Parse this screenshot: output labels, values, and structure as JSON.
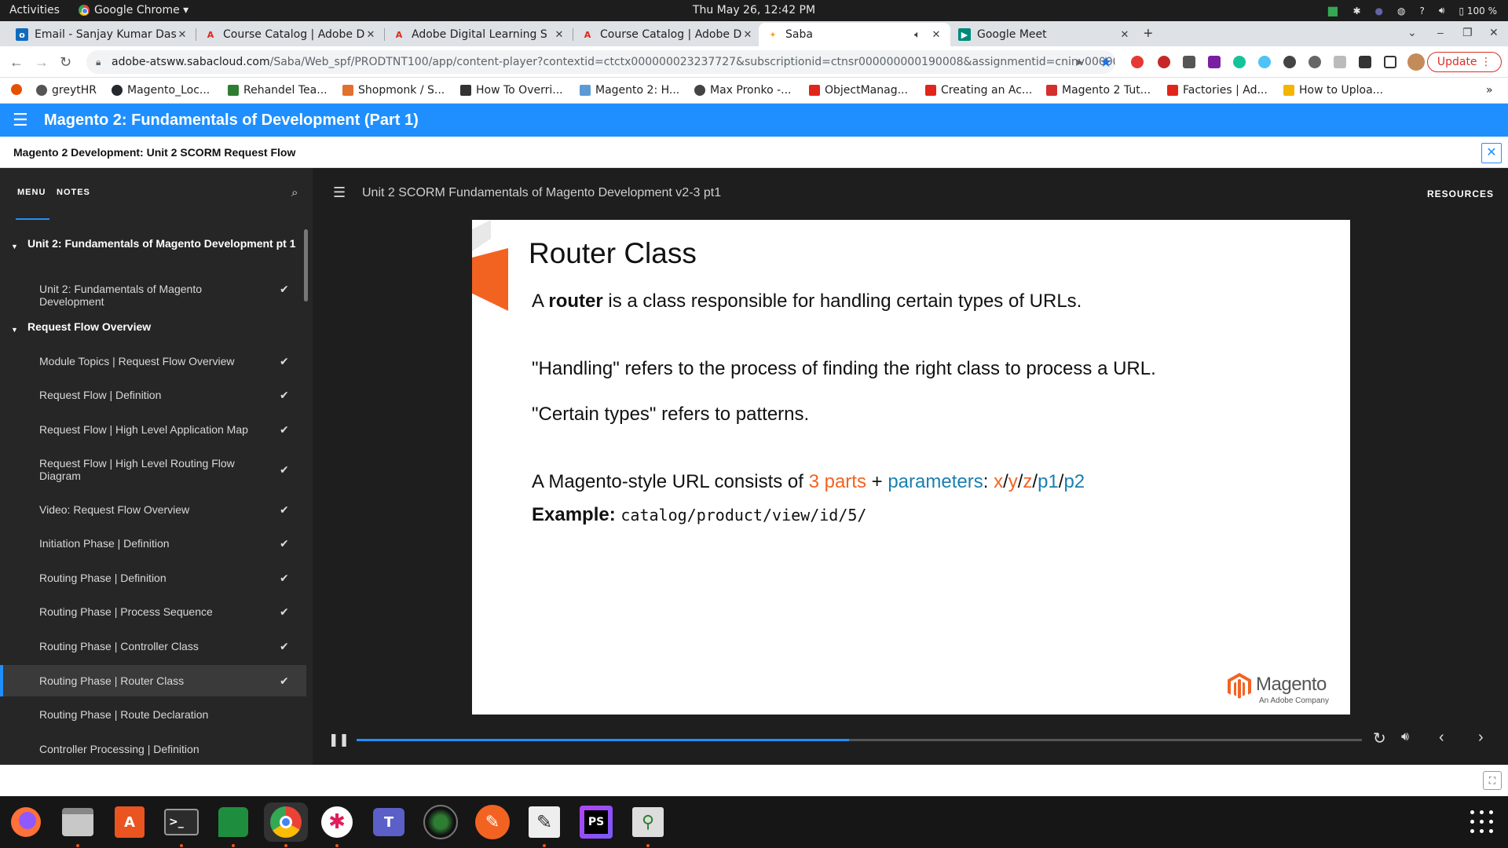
{
  "topbar": {
    "activities": "Activities",
    "app_name": "Google Chrome ▾",
    "clock": "Thu May 26, 12:42 PM",
    "battery": "100 %"
  },
  "tabs": [
    {
      "title": "Email - Sanjay Kumar Das",
      "icon": "outlook-icon",
      "color": "#0f6cbd"
    },
    {
      "title": "Course Catalog | Adobe D",
      "icon": "adobe-icon",
      "color": "#e1251b"
    },
    {
      "title": "Adobe Digital Learning S",
      "icon": "adobe-icon",
      "color": "#e1251b"
    },
    {
      "title": "Course Catalog | Adobe D",
      "icon": "adobe-icon",
      "color": "#e1251b"
    },
    {
      "title": "Saba",
      "icon": "saba-icon",
      "color": "#f5a623",
      "active": true
    },
    {
      "title": "Google Meet",
      "icon": "meet-icon",
      "color": "#00897b"
    }
  ],
  "address": {
    "host": "adobe-atsww.sabacloud.com",
    "path": "/Saba/Web_spf/PRODTNT100/app/content-player?contextid=ctctx000000023237727&subscriptionid=ctnsr000000000190008&assignmentid=cninv00000000007..."
  },
  "update_label": "Update",
  "bookmarks": [
    {
      "label": "greytHR",
      "color": "#555555"
    },
    {
      "label": "Magento_Loc...",
      "color": "#24292e"
    },
    {
      "label": "Rehandel Tea...",
      "color": "#2e7d32"
    },
    {
      "label": "Shopmonk / S...",
      "color": "#e2702f"
    },
    {
      "label": "How To Overri...",
      "color": "#333333"
    },
    {
      "label": "Magento 2: H...",
      "color": "#5b9bd5"
    },
    {
      "label": "Max Pronko -...",
      "color": "#444444"
    },
    {
      "label": "ObjectManag...",
      "color": "#e1251b"
    },
    {
      "label": "Creating an Ac...",
      "color": "#e1251b"
    },
    {
      "label": "Magento 2 Tut...",
      "color": "#d32f2f"
    },
    {
      "label": "Factories | Ad...",
      "color": "#e1251b"
    },
    {
      "label": "How to Uploa...",
      "color": "#f4b400"
    }
  ],
  "course": {
    "title": "Magento 2: Fundamentals of Development (Part 1)",
    "subtitle": "Magento 2 Development: Unit 2 SCORM Request Flow"
  },
  "sidebar": {
    "tab_menu": "MENU",
    "tab_notes": "NOTES",
    "sections": [
      {
        "title": "Unit 2: Fundamentals of Magento Development pt 1"
      },
      {
        "title": "Request Flow Overview"
      }
    ],
    "items": [
      {
        "label": "Unit 2: Fundamentals of Magento Development",
        "done": true
      },
      {
        "label": "Module Topics | Request Flow Overview",
        "done": true
      },
      {
        "label": "Request Flow | Definition",
        "done": true
      },
      {
        "label": "Request Flow | High Level Application Map",
        "done": true
      },
      {
        "label": "Request Flow | High Level Routing Flow Diagram",
        "done": true
      },
      {
        "label": "Video: Request Flow Overview",
        "done": true
      },
      {
        "label": "Initiation Phase | Definition",
        "done": true
      },
      {
        "label": "Routing Phase | Definition",
        "done": true
      },
      {
        "label": "Routing Phase | Process Sequence",
        "done": true
      },
      {
        "label": "Routing Phase | Controller Class",
        "done": true
      },
      {
        "label": "Routing Phase | Router Class",
        "done": true,
        "current": true
      },
      {
        "label": "Routing Phase | Route Declaration",
        "done": false
      },
      {
        "label": "Controller Processing | Definition",
        "done": false
      }
    ]
  },
  "content": {
    "header_title": "Unit 2 SCORM Fundamentals of Magento Development v2-3 pt1",
    "resources": "RESOURCES"
  },
  "slide": {
    "heading": "Router Class",
    "line1_pre": "A ",
    "line1_bold": "router",
    "line1_post": " is a class responsible for handling certain types of URLs.",
    "line2": "\"Handling\" refers to the process of finding the right class to process a URL.",
    "line3": "\"Certain types\" refers to patterns.",
    "line4_pre": "A Magento-style URL consists of ",
    "line4_parts": "3 parts",
    "line4_plus": " + ",
    "line4_params": "parameters",
    "line4_colon": ": ",
    "url_x": "x",
    "url_y": "y",
    "url_z": "z",
    "url_p1": "p1",
    "url_p2": "p2",
    "slash": "/",
    "example_label": "Example:",
    "example_code": "catalog/product/view/id/5/",
    "logo_word": "Magento",
    "logo_sub": "An Adobe Company",
    "colors": {
      "orange": "#f26322",
      "blue": "#1a7fb0"
    }
  },
  "player": {
    "progress": 0.49
  },
  "dock": [
    {
      "name": "firefox-icon"
    },
    {
      "name": "files-icon"
    },
    {
      "name": "software-center-icon"
    },
    {
      "name": "terminal-icon"
    },
    {
      "name": "google-chat-icon"
    },
    {
      "name": "chrome-icon"
    },
    {
      "name": "slack-icon"
    },
    {
      "name": "teams-icon"
    },
    {
      "name": "camera-icon"
    },
    {
      "name": "pen-icon"
    },
    {
      "name": "text-editor-icon"
    },
    {
      "name": "phpstorm-icon"
    },
    {
      "name": "image-viewer-icon"
    }
  ]
}
